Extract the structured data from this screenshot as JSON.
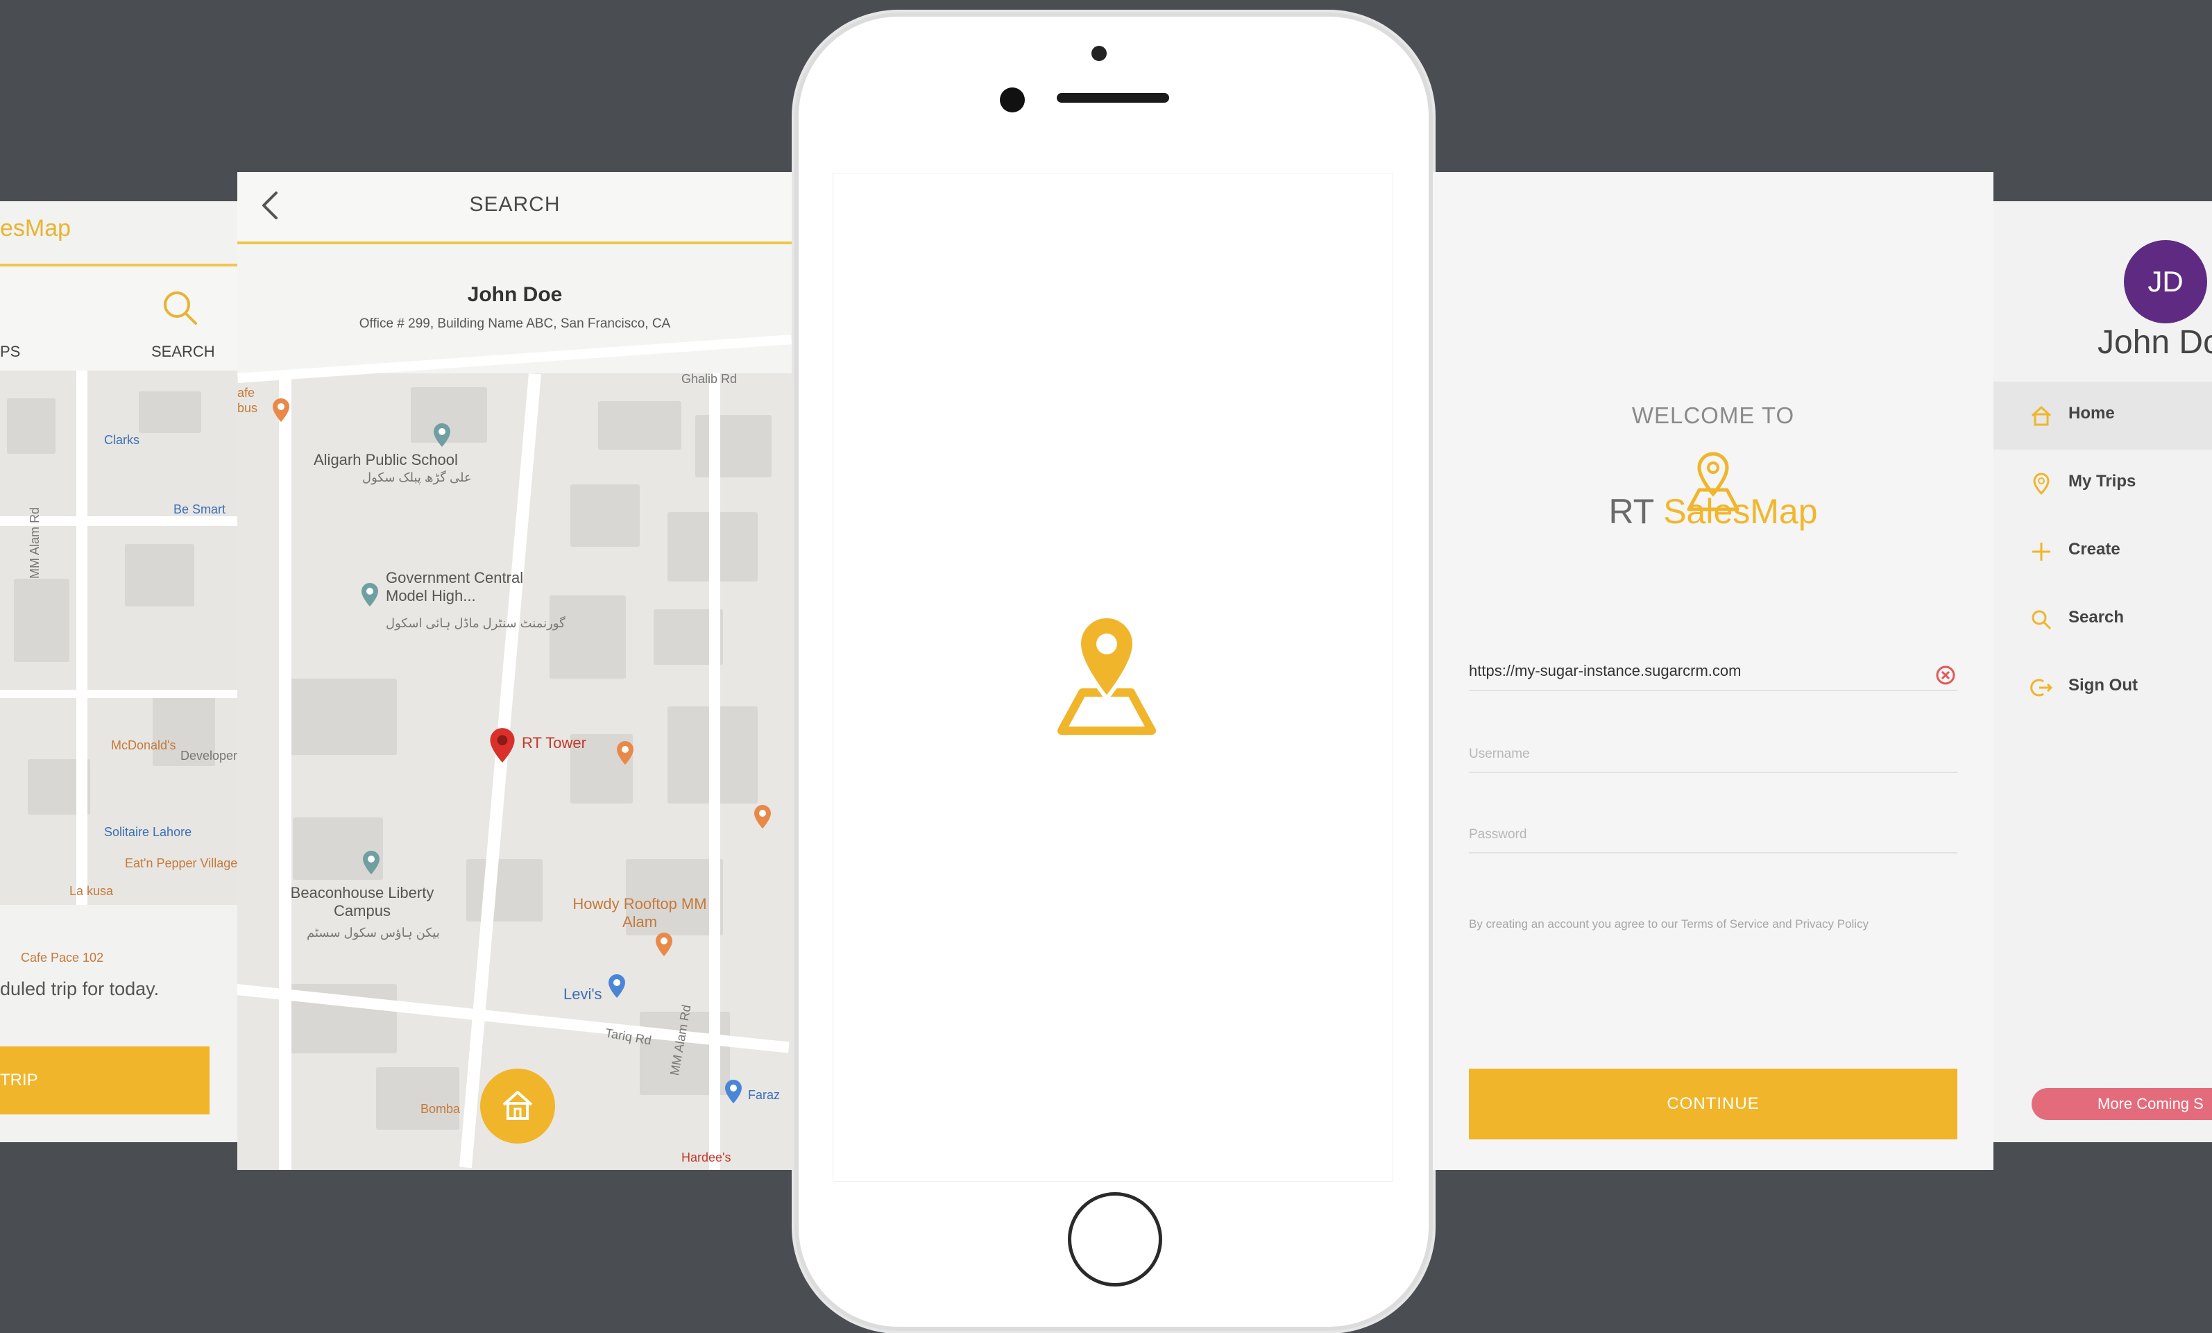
{
  "colors": {
    "background": "#4a4d52",
    "accent": "#f0b52a",
    "avatar": "#5e2a82",
    "more_coming": "#e46b7b"
  },
  "home_screen": {
    "app_title": "esMap",
    "nav": {
      "left_label": "PS",
      "search_label": "SEARCH"
    },
    "map_labels": [
      "Clarks",
      "Be Smart",
      "McDonald's",
      "Developer",
      "Solitaire Lahore",
      "Eat'n Pepper Village Lahore",
      "La kusa",
      "Cafe Pace 102",
      "MM Alam Rd"
    ],
    "message": "duled trip for today.",
    "trip_button": "TRIP"
  },
  "search_screen": {
    "title": "SEARCH",
    "user_name": "John Doe",
    "user_address": "Office # 299, Building Name ABC, San Francisco, CA",
    "map_labels": {
      "school": "Aligarh Public School",
      "school_urdu": "علی گڑھ پبلک سکول",
      "gov": "Government Central Model High...",
      "gov_urdu": "گورنمنٹ سنٹرل ماڈل ہائی اسکول",
      "rt_tower": "RT Tower",
      "beacon": "Beaconhouse Liberty Campus",
      "beacon_urdu": "بیکن ہاؤس سکول سسٹم",
      "howdy": "Howdy Rooftop MM Alam",
      "levis": "Levi's",
      "faraz": "Faraz",
      "bombay": "Bomba",
      "hardees": "Hardee's",
      "ghalib": "Ghalib Rd",
      "mm_alam": "MM Alam Rd",
      "tariq": "Tariq Rd",
      "cafe": "afe",
      "bus": "bus"
    }
  },
  "phone": {
    "logo_icon": "map-pin-icon"
  },
  "login_screen": {
    "welcome": "WELCOME TO",
    "brand_prefix": "RT ",
    "brand_accent": "SalesMap",
    "url_value": "https://my-sugar-instance.sugarcrm.com",
    "username_placeholder": "Username",
    "password_placeholder": "Password",
    "terms": "By creating an account you agree to our Terms of Service and Privacy Policy",
    "continue": "CONTINUE"
  },
  "menu_screen": {
    "avatar_initials": "JD",
    "user_name": "John Dc",
    "items": [
      {
        "label": "Home",
        "icon": "home-icon",
        "active": true
      },
      {
        "label": "My Trips",
        "icon": "pin-icon",
        "active": false
      },
      {
        "label": "Create",
        "icon": "plus-icon",
        "active": false
      },
      {
        "label": "Search",
        "icon": "search-icon",
        "active": false
      },
      {
        "label": "Sign Out",
        "icon": "sign-out-icon",
        "active": false
      }
    ],
    "more_coming": "More Coming S"
  }
}
